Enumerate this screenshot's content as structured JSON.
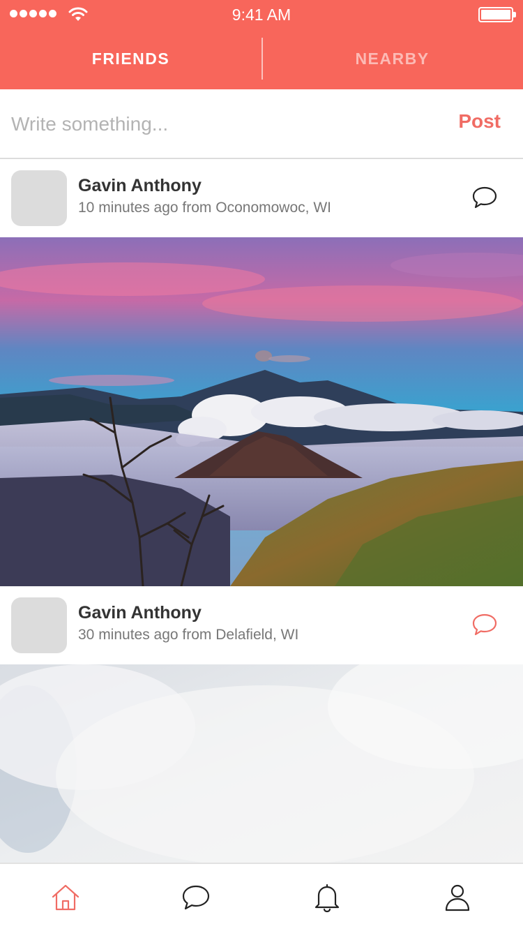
{
  "status_bar": {
    "time": "9:41 AM"
  },
  "header": {
    "tabs": [
      {
        "label": "FRIENDS",
        "active": true
      },
      {
        "label": "NEARBY",
        "active": false
      }
    ],
    "background": "#F8665B"
  },
  "composer": {
    "placeholder": "Write something...",
    "post_label": "Post"
  },
  "feed": [
    {
      "author": "Gavin Anthony",
      "meta": "10 minutes ago from Oconomowoc, WI",
      "comment_icon": "comment-icon",
      "comment_color": "#222222",
      "photo": "volcano-landscape"
    },
    {
      "author": "Gavin Anthony",
      "meta": "30 minutes ago from Delafield, WI",
      "comment_icon": "comment-icon",
      "comment_color": "#F06C64",
      "photo": "cloudy-sky"
    }
  ],
  "tabbar": {
    "items": [
      {
        "icon": "home-icon",
        "active": true
      },
      {
        "icon": "chat-icon",
        "active": false
      },
      {
        "icon": "bell-icon",
        "active": false
      },
      {
        "icon": "profile-icon",
        "active": false
      }
    ],
    "accent": "#F06C64"
  }
}
